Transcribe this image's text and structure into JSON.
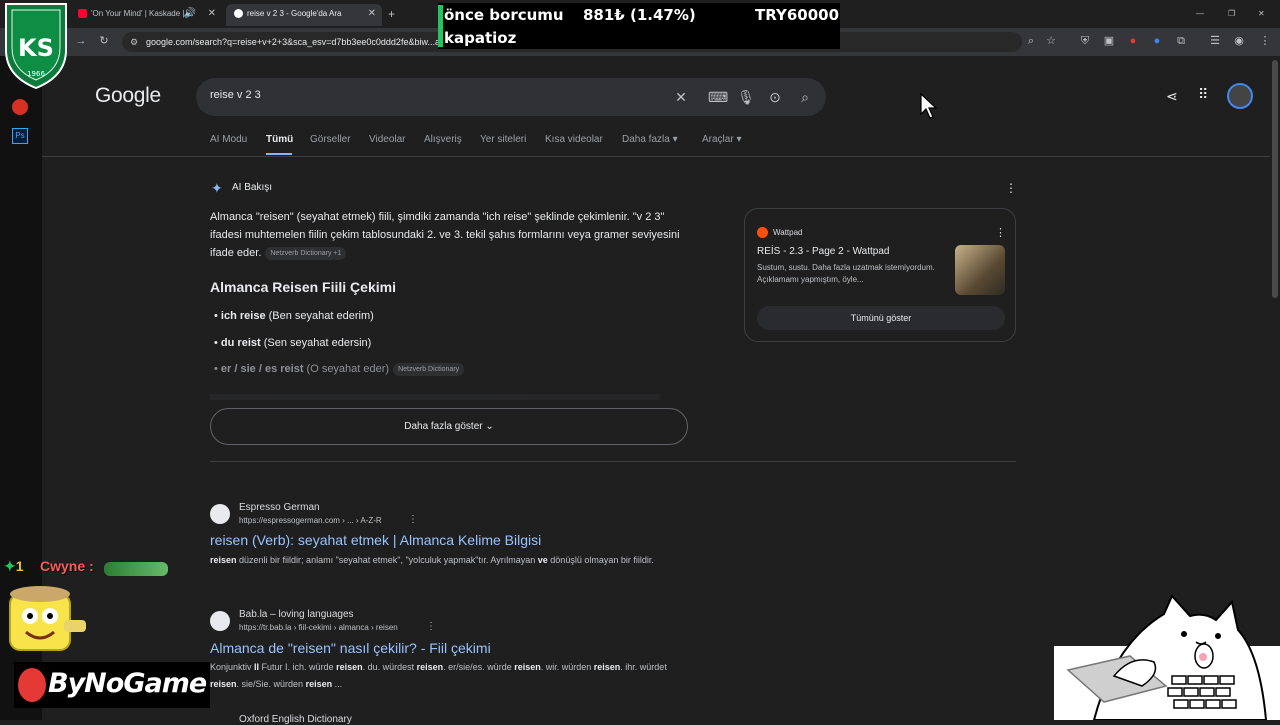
{
  "browser": {
    "tabs": [
      {
        "title": "'On Your Mind' | Kaskade | ..."
      },
      {
        "title": "reise v 2 3 - Google'da Ara"
      }
    ],
    "new_tab": "+",
    "url": "google.com/search?q=reise+v+2+3&sca_esv=d7bb3ee0c0ddd2fe&biw...aoecEJyPxc8P09_y4Qc&ved=0ahUKEwi...",
    "window_controls": {
      "minimize": "—",
      "restore": "❐",
      "close": "✕"
    }
  },
  "ticker": {
    "line1": "önce borcumu",
    "line2": "kapatioz",
    "amount": "881₺ (1.47%)",
    "goal": "TRY60000"
  },
  "google": {
    "logo": "Google",
    "query": "reise v 2 3",
    "nav_tabs": [
      "AI Modu",
      "Tümü",
      "Görseller",
      "Videolar",
      "Alışveriş",
      "Yer siteleri",
      "Kısa videolar",
      "Daha fazla ▾",
      "Araçlar ▾"
    ],
    "active_tab": "Tümü"
  },
  "ai_overview": {
    "label": "AI Bakışı",
    "paragraph": "Almanca \"reisen\" (seyahat etmek) fiili, şimdiki zamanda \"ich reise\" şeklinde çekimlenir. \"v 2 3\" ifadesi muhtemelen fiilin çekim tablosundaki 2. ve 3. tekil şahıs formlarını veya gramer seviyesini ifade eder.",
    "paragraph_chip": "Netzverb Dictionary +1",
    "heading": "Almanca Reisen Fiili Çekimi",
    "bullets": [
      {
        "bold": "ich reise",
        "rest": " (Ben seyahat ederim)"
      },
      {
        "bold": "du reist",
        "rest": " (Sen seyahat edersin)"
      },
      {
        "bold": "er / sie / es reist",
        "rest": " (O seyahat eder)",
        "chip": "Netzverb Dictionary"
      }
    ],
    "more_button": "Daha fazla göster",
    "card": {
      "source": "Wattpad",
      "title": "REİS - 2.3 - Page 2 - Wattpad",
      "snippet": "Sustum, sustu. Daha fazla uzatmak istemiyordum. Açıklamamı yapmıştım, öyle...",
      "show_all": "Tümünü göster"
    }
  },
  "results": [
    {
      "site": "Espresso German",
      "url": "https://espressogerman.com › ... › A-Z-R",
      "title": "reisen (Verb): seyahat etmek | Almanca Kelime Bilgisi",
      "snippet_html": "<b>reisen</b> düzenli bir fiildir; anlamı \"seyahat etmek\", \"yolculuk yapmak\"tır. Ayrılmayan <b>ve</b> dönüşlü olmayan bir fiildir."
    },
    {
      "site": "Bab.la – loving languages",
      "url": "https://tr.bab.la › fiil-cekimi › almanca › reisen",
      "title": "Almanca de \"reisen\" nasıl çekilir? - Fiil çekimi",
      "snippet_html": "Konjunktiv <b>II</b> Futur I. ich. würde <b>reisen</b>. du. würdest <b>reisen</b>. er/sie/es. würde <b>reisen</b>. wir. würden <b>reisen</b>. ihr. würdet <b>reisen</b>. sie/Sie. würden <b>reisen</b> ..."
    },
    {
      "site": "Oxford English Dictionary"
    }
  ],
  "overlay": {
    "chat_user": "Cwyne :",
    "chat_badge": "1",
    "brand": "ByNoGame",
    "emblem_letters": "KS",
    "emblem_year": "1966",
    "ps_label": "Ps"
  },
  "colors": {
    "link": "#99c3ff",
    "bg": "#1f1f1f",
    "ticker_bar": "#22c55e",
    "emblem": "#0b7a3b"
  }
}
